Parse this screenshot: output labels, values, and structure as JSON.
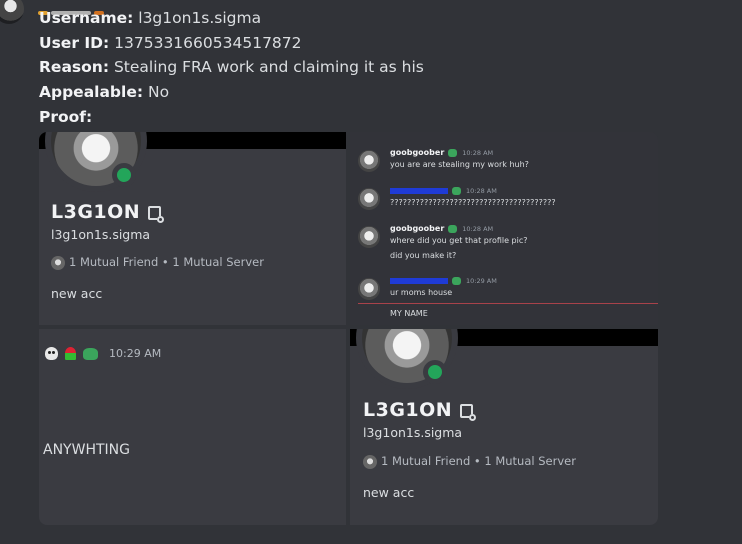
{
  "colors": {
    "online": "#23a55a",
    "new_marker": "#a8424a",
    "mention_blue": "#1f3bd6",
    "role_badge": "#3ba55c"
  },
  "fields": [
    {
      "label": "Username:",
      "value": "l3g1on1s.sigma"
    },
    {
      "label": "User ID:",
      "value": "1375331660534517872"
    },
    {
      "label": "Reason:",
      "value": "Stealing FRA work and claiming it as his"
    },
    {
      "label": "Appealable:",
      "value": "No"
    },
    {
      "label": "Proof:",
      "value": ""
    }
  ],
  "profile_card": {
    "name": "L3G1ON",
    "handle": "l3g1on1s.sigma",
    "mutual_friend": "1 Mutual Friend",
    "mutual_server": "1 Mutual Server",
    "separator": "•",
    "bio": "new acc",
    "status": "online",
    "name_icon": "note-icon"
  },
  "chat": {
    "messages": [
      {
        "user": "goobgoober",
        "time": "10:28 AM",
        "lines": [
          "you are are stealing my work huh?"
        ]
      },
      {
        "user": "",
        "time": "10:28 AM",
        "lines": [
          "???????????????????????????????????????"
        ]
      },
      {
        "user": "goobgoober",
        "time": "10:28 AM",
        "lines": [
          "where did you get that profile pic?",
          "did you make it?"
        ]
      },
      {
        "user": "",
        "time": "10:29 AM",
        "lines": [
          "ur moms house"
        ]
      }
    ],
    "trailing_line": "MY NAME"
  },
  "reaction_cell": {
    "icons": [
      "skull-icon",
      "rose-icon",
      "frog-icon"
    ],
    "time": "10:29 AM",
    "text": "ANYWHTING"
  }
}
